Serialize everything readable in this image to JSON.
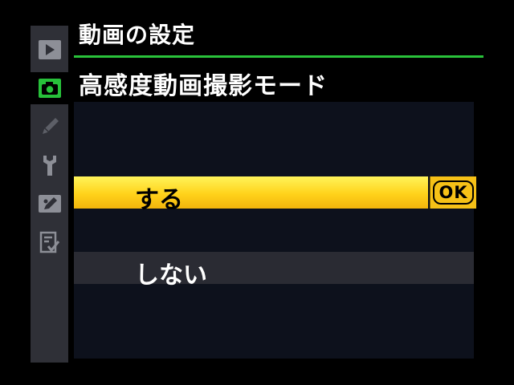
{
  "menu": {
    "title": "動画の設定",
    "subtitle": "高感度動画撮影モード"
  },
  "sidebar": {
    "items": [
      {
        "icon": "playback-icon",
        "active": false
      },
      {
        "icon": "camera-icon",
        "active": true
      },
      {
        "icon": "pencil-icon",
        "active": false
      },
      {
        "icon": "wrench-icon",
        "active": false
      },
      {
        "icon": "retouch-icon",
        "active": false
      },
      {
        "icon": "my-menu-icon",
        "active": false
      }
    ]
  },
  "options": [
    {
      "label": "する",
      "selected": true,
      "confirm_label": "OK"
    },
    {
      "label": "しない",
      "selected": false
    }
  ],
  "colors": {
    "accent_green": "#29c23a",
    "highlight_yellow": "#ffd21a",
    "sidebar_bg": "#2f3037",
    "panel_bg": "#0d111c"
  }
}
